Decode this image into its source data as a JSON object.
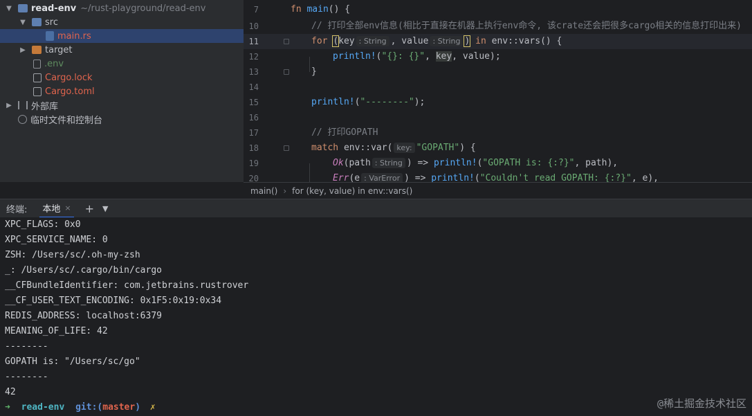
{
  "tree": {
    "root_name": "read-env",
    "root_path": "~/rust-playground/read-env",
    "src": "src",
    "main": "main.rs",
    "target": "target",
    "env": ".env",
    "cargo_lock": "Cargo.lock",
    "cargo_toml": "Cargo.toml",
    "external_libs": "外部库",
    "scratches": "临时文件和控制台"
  },
  "editor": {
    "line_numbers": [
      "7",
      "10",
      "11",
      "12",
      "13",
      "14",
      "15",
      "16",
      "17",
      "18",
      "19",
      "20"
    ],
    "l7_kw": "fn",
    "l7_name": "main",
    "l7_rest": "() {",
    "l10_comment": "// 打印全部env信息(相比于直接在机器上执行env命令, 该crate还会把很多cargo相关的信息打印出来)",
    "l11_for": "for",
    "l11_key": "key",
    "l11_hint1": ": String",
    "l11_comma": ", value",
    "l11_hint2": ": String",
    "l11_in": "in",
    "l11_rest": "env::vars() {",
    "l12_macro": "println!",
    "l12_str": "\"{}: {}\"",
    "l12_key": "key",
    "l12_rest": ", value);",
    "l13": "}",
    "l15_macro": "println!",
    "l15_str": "\"--------\"",
    "l15_rest": ");",
    "l17_comment": "// 打印GOPATH",
    "l18_kw": "match",
    "l18_call": "env::var(",
    "l18_hint": "key:",
    "l18_str": "\"GOPATH\"",
    "l18_rest": ") {",
    "l19_ok": "Ok",
    "l19_path": "(path",
    "l19_hint": ": String",
    "l19_arrow": ") =>",
    "l19_macro": "println!",
    "l19_str": "\"GOPATH is: {:?}\"",
    "l19_rest": ", path),",
    "l20_err": "Err",
    "l20_e": "(e",
    "l20_hint": ": VarError",
    "l20_arrow": ") =>",
    "l20_macro": "println!",
    "l20_str": "\"Couldn't read GOPATH: {:?}\"",
    "l20_rest": ", e),"
  },
  "breadcrumb": {
    "item1": "main()",
    "item2": "for (key, value) in env::vars()"
  },
  "terminal": {
    "title": "终端:",
    "tab": "本地",
    "close": "×",
    "add": "+",
    "menu": "⌄",
    "lines": [
      "XPC_FLAGS: 0x0",
      "XPC_SERVICE_NAME: 0",
      "ZSH: /Users/sc/.oh-my-zsh",
      "_: /Users/sc/.cargo/bin/cargo",
      "__CFBundleIdentifier: com.jetbrains.rustrover",
      "__CF_USER_TEXT_ENCODING: 0x1F5:0x19:0x34",
      "REDIS_ADDRESS: localhost:6379",
      "MEANING_OF_LIFE: 42",
      "--------",
      "GOPATH is: \"/Users/sc/go\"",
      "--------",
      "42"
    ],
    "prompt_arrow": "➜",
    "prompt_dir": "read-env",
    "prompt_git": "git:(",
    "prompt_branch": "master",
    "prompt_close": ")",
    "prompt_x": "✗"
  },
  "watermark": "@稀土掘金技术社区"
}
